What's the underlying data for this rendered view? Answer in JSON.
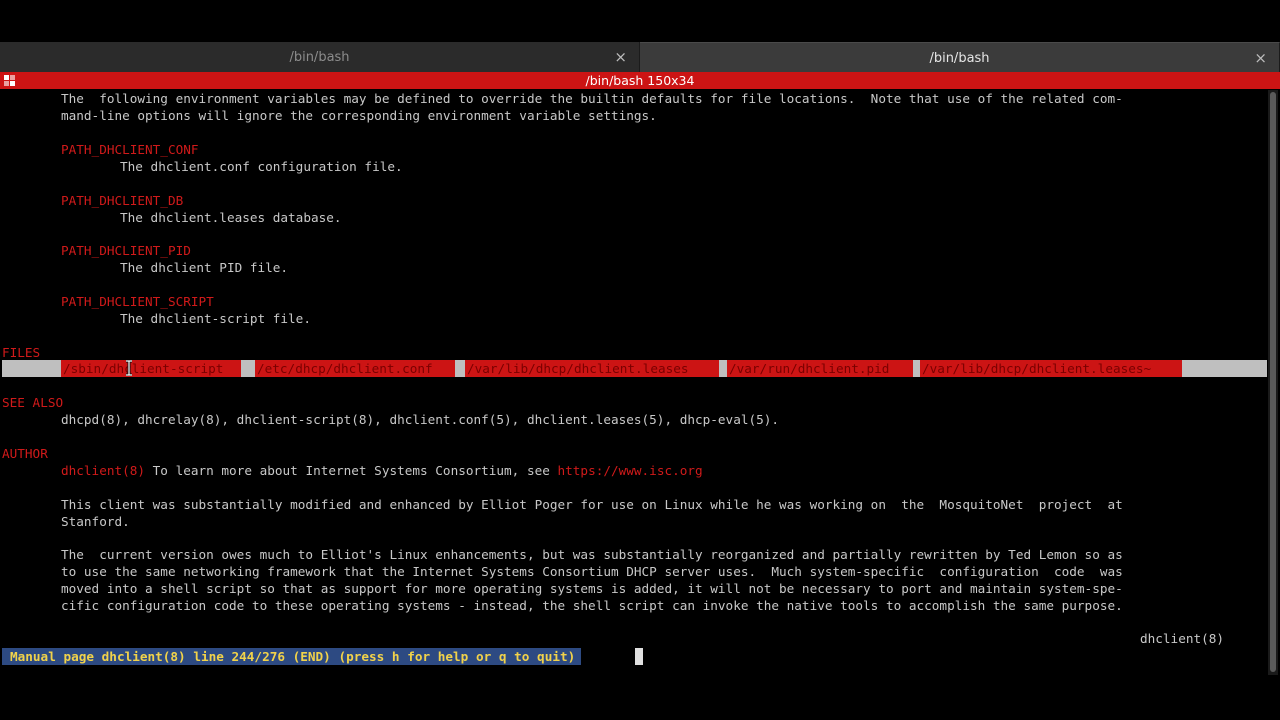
{
  "tabs": [
    {
      "label": "/bin/bash",
      "active": false
    },
    {
      "label": "/bin/bash",
      "active": true
    }
  ],
  "tab_close_glyph": "×",
  "title": "/bin/bash 150x34",
  "lines": {
    "env_intro_1": "The  following environment variables may be defined to override the builtin defaults for file locations.  Note that use of the related com-",
    "env_intro_2": "mand-line options will ignore the corresponding environment variable settings.",
    "var_conf": "PATH_DHCLIENT_CONF",
    "desc_conf": "The dhclient.conf configuration file.",
    "var_db": "PATH_DHCLIENT_DB",
    "desc_db": "The dhclient.leases database.",
    "var_pid": "PATH_DHCLIENT_PID",
    "desc_pid": "The dhclient PID file.",
    "var_script": "PATH_DHCLIENT_SCRIPT",
    "desc_script": "The dhclient-script file.",
    "files_header": "FILES",
    "see_also_header": "SEE ALSO",
    "see_also_text": "dhcpd(8), dhcrelay(8), dhclient-script(8), dhclient.conf(5), dhclient.leases(5), dhcp-eval(5).",
    "author_header": "AUTHOR",
    "author_ref": "dhclient(8)",
    "author_text": " To learn more about Internet Systems Consortium, see ",
    "author_link": "https://www.isc.org",
    "para1_1": "This client was substantially modified and enhanced by Elliot Poger for use on Linux while he was working on  the  MosquitoNet  project  at",
    "para1_2": "Stanford.",
    "para2_1": "The  current version owes much to Elliot's Linux enhancements, but was substantially reorganized and partially rewritten by Ted Lemon so as",
    "para2_2": "to use the same networking framework that the Internet Systems Consortium DHCP server uses.  Much system-specific  configuration  code  was",
    "para2_3": "moved into a shell script so that as support for more operating systems is added, it will not be necessary to port and maintain system-spe-",
    "para2_4": "cific configuration code to these operating systems - instead, the shell script can invoke the native tools to accomplish the same purpose.",
    "footer_right": "dhclient(8)"
  },
  "files": [
    "/sbin/dhclient-script",
    "/etc/dhcp/dhclient.conf",
    "/var/lib/dhcp/dhclient.leases",
    "/var/run/dhclient.pid",
    "/var/lib/dhcp/dhclient.leases~"
  ],
  "status": "Manual page dhclient(8) line 244/276 (END) (press h for help or q to quit)"
}
